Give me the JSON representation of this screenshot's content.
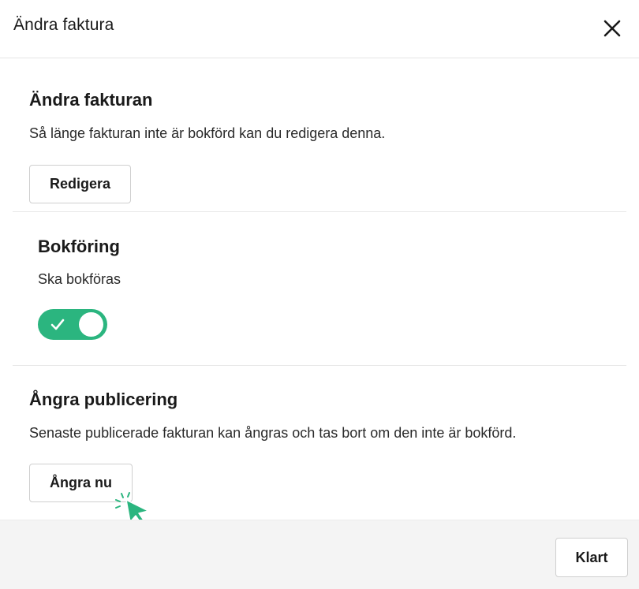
{
  "dialog": {
    "title": "Ändra faktura",
    "close_icon": "close-icon"
  },
  "edit_section": {
    "title": "Ändra fakturan",
    "description": "Så länge fakturan inte är bokförd kan du redigera denna.",
    "button_label": "Redigera"
  },
  "bookkeeping_section": {
    "title": "Bokföring",
    "description": "Ska bokföras",
    "toggle_on": true,
    "toggle_icon": "checkmark-icon"
  },
  "undo_section": {
    "title": "Ångra publicering",
    "description": "Senaste publicerade fakturan kan ångras och tas bort om den inte är bokförd.",
    "button_label": "Ångra nu"
  },
  "footer": {
    "done_label": "Klart"
  },
  "colors": {
    "accent": "#2bb57f",
    "footer_bg": "#f4f4f4",
    "border": "#cfcfcf"
  }
}
